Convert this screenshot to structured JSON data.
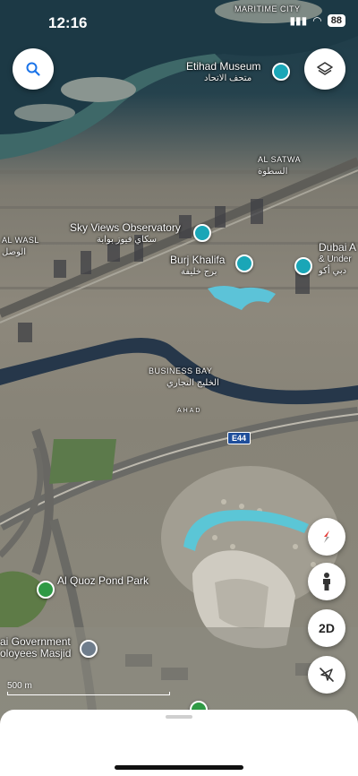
{
  "status_bar": {
    "time": "12:16",
    "battery": "88"
  },
  "top_label": "MARITIME CITY",
  "places": {
    "etihad": {
      "name": "Etihad Museum",
      "sub": "متحف الاتحاد"
    },
    "alsatwa": {
      "name": "AL SATWA",
      "sub": "السطوة"
    },
    "alwasl": {
      "name": "AL WASL",
      "sub": "الوصل"
    },
    "skyviews": {
      "name": "Sky Views Observatory",
      "sub": "سكاي فيوز بوابة"
    },
    "burj": {
      "name": "Burj Khalifa",
      "sub": "برج خليفة"
    },
    "dubaiaq": {
      "name": "Dubai A",
      "sub": "& Under"
    },
    "dubaiaq_ar": {
      "name": "",
      "sub": "دبي أكو"
    },
    "businessbay": {
      "name": "BUSINESS BAY",
      "sub": "الخليج التجاري"
    },
    "ahad": {
      "name": "AHAD",
      "sub": ""
    },
    "quzpond": {
      "name": "Al Quoz Pond Park"
    },
    "masjid": {
      "name": "ai Government",
      "sub": "oloyees Masjid"
    }
  },
  "road": {
    "shield": "E44"
  },
  "scale": {
    "label": "500 m"
  },
  "controls": {
    "twod_label": "2D"
  },
  "icons": {
    "search": "search-icon",
    "layers": "layers-icon",
    "compass": "compass-icon",
    "street_view": "pegman-icon",
    "location": "location-off-icon"
  }
}
